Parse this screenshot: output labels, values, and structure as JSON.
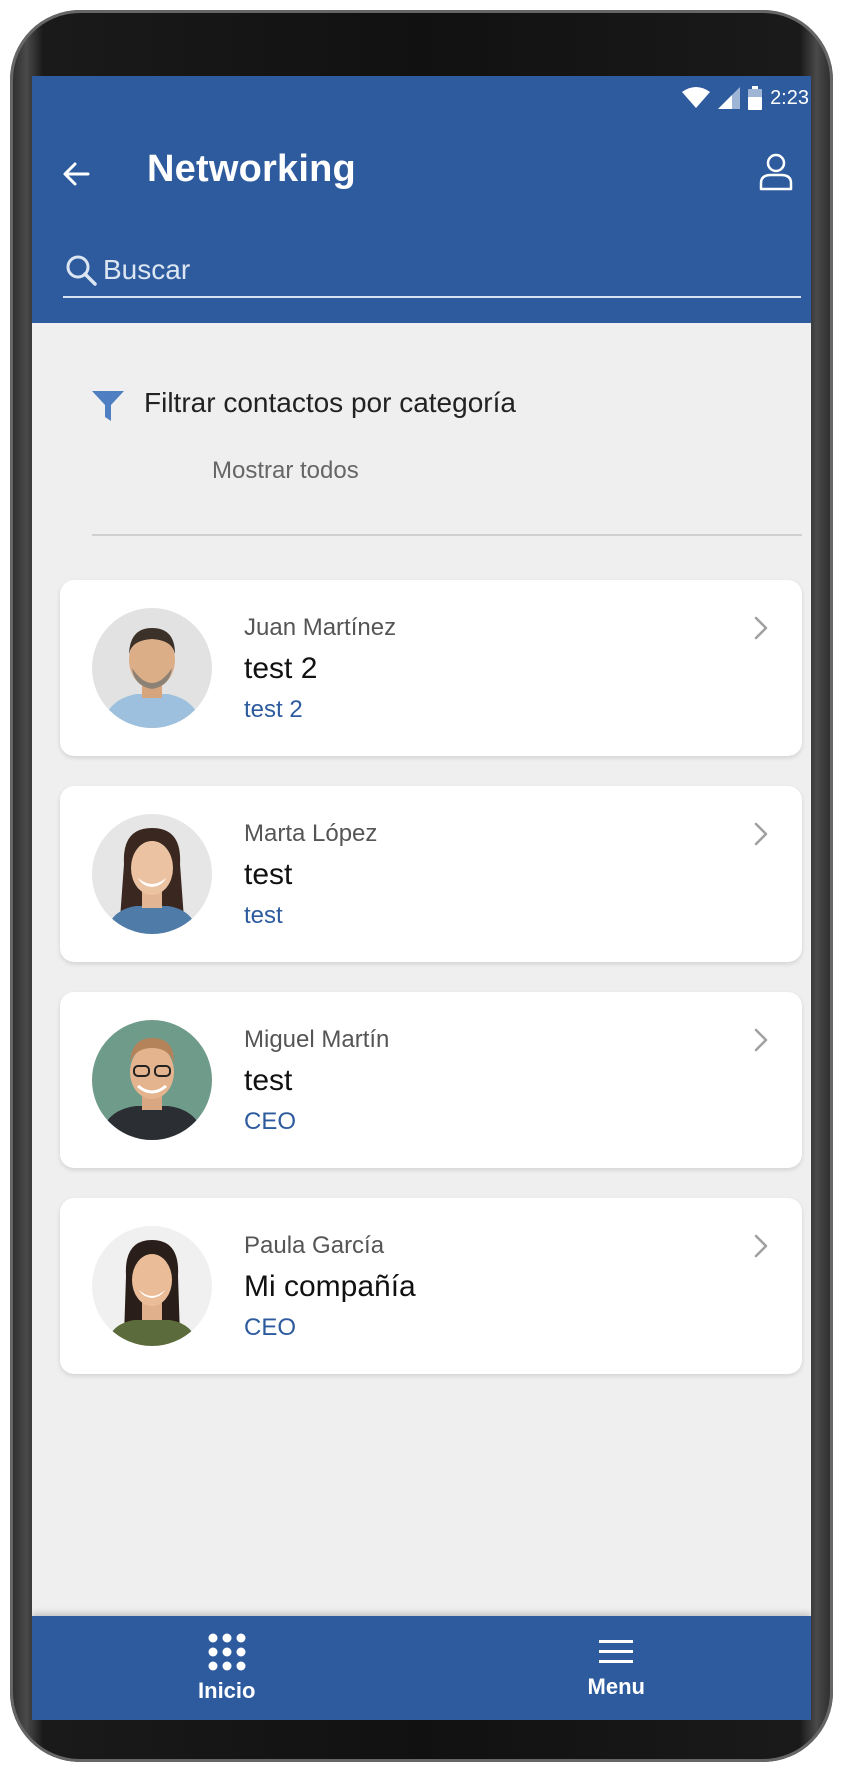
{
  "status_bar": {
    "time": "2:23"
  },
  "header": {
    "title": "Networking",
    "back_icon": "arrow-left-icon",
    "profile_icon": "user-icon"
  },
  "search": {
    "placeholder": "Buscar",
    "value": ""
  },
  "filter": {
    "label": "Filtrar contactos por categoría",
    "selected": "Mostrar todos",
    "icon": "funnel-icon"
  },
  "contacts": [
    {
      "name": "Juan Martínez",
      "company": "test 2",
      "role": "test 2"
    },
    {
      "name": "Marta López",
      "company": "test",
      "role": "test"
    },
    {
      "name": "Miguel Martín",
      "company": "test",
      "role": "CEO"
    },
    {
      "name": "Paula García",
      "company": "Mi compañía",
      "role": "CEO"
    }
  ],
  "bottom_nav": {
    "items": [
      {
        "label": "Inicio",
        "icon": "grid-icon"
      },
      {
        "label": "Menu",
        "icon": "hamburger-icon"
      }
    ]
  },
  "colors": {
    "primary": "#2d5b9e",
    "background": "#efefef",
    "card": "#ffffff",
    "role_text": "#2d5b9e"
  }
}
